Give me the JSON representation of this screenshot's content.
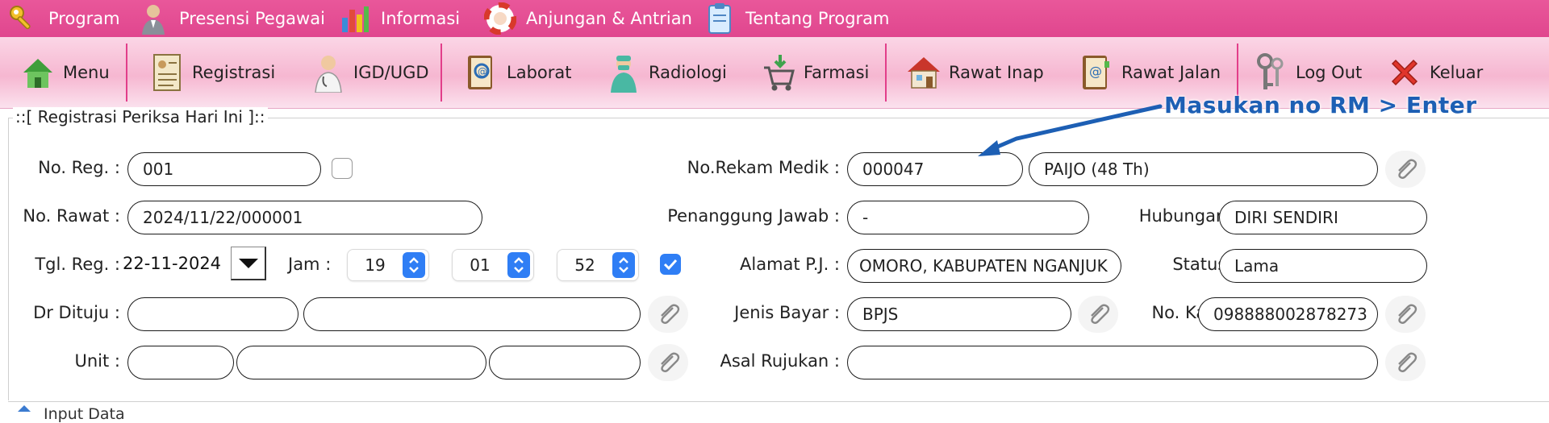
{
  "menubar": {
    "items": [
      {
        "label": "Program",
        "icon": "keys-icon"
      },
      {
        "label": "Presensi Pegawai",
        "icon": "employee-icon"
      },
      {
        "label": "Informasi",
        "icon": "chart-icon"
      },
      {
        "label": "Anjungan & Antrian",
        "icon": "lifebuoy-icon"
      },
      {
        "label": "Tentang Program",
        "icon": "clipboard-icon"
      }
    ]
  },
  "toolbar": {
    "items": [
      {
        "label": "Menu",
        "icon": "home-icon"
      },
      {
        "label": "Registrasi",
        "icon": "register-icon"
      },
      {
        "label": "IGD/UGD",
        "icon": "doctor-icon"
      },
      {
        "label": "Laborat",
        "icon": "lab-book-icon"
      },
      {
        "label": "Radiologi",
        "icon": "surgeon-icon"
      },
      {
        "label": "Farmasi",
        "icon": "pharmacy-cart-icon"
      },
      {
        "label": "Rawat Inap",
        "icon": "house-icon"
      },
      {
        "label": "Rawat Jalan",
        "icon": "address-book-icon"
      },
      {
        "label": "Log Out",
        "icon": "keys-logout-icon"
      },
      {
        "label": "Keluar",
        "icon": "red-x-icon"
      }
    ]
  },
  "panel": {
    "title": "::[ Registrasi Periksa Hari Ini ]::"
  },
  "annotation": {
    "text": "Masukan no RM  >  Enter"
  },
  "form": {
    "no_reg": {
      "label": "No. Reg. :",
      "value": "001",
      "checked": false
    },
    "no_rawat": {
      "label": "No. Rawat :",
      "value": "2024/11/22/000001"
    },
    "tgl_reg": {
      "label": "Tgl. Reg. :",
      "value": "22-11-2024"
    },
    "jam": {
      "label": "Jam :",
      "hour": "19",
      "minute": "01",
      "second": "52",
      "auto_checked": true
    },
    "dr_dituju": {
      "label": "Dr Dituju :",
      "code": "",
      "name": ""
    },
    "unit": {
      "label": "Unit :",
      "code": "",
      "name": "",
      "extra": ""
    },
    "no_rm": {
      "label": "No.Rekam Medik :",
      "value": "000047",
      "patient": "PAIJO (48 Th)"
    },
    "penanggung": {
      "label": "Penanggung Jawab :",
      "value": "-"
    },
    "hubungan": {
      "label": "Hubungan :",
      "value": "DIRI SENDIRI"
    },
    "alamat": {
      "label": "Alamat P.J. :",
      "value": "OMORO, KABUPATEN NGANJUK"
    },
    "status": {
      "label": "Status :",
      "value": "Lama"
    },
    "jenis_bayar": {
      "label": "Jenis Bayar :",
      "value": "BPJS"
    },
    "no_ka": {
      "label": "No. Ka :",
      "value": "098888002878273"
    },
    "asal_rujukan": {
      "label": "Asal Rujukan :",
      "value": ""
    }
  },
  "footer": {
    "tab_label": "Input Data"
  }
}
